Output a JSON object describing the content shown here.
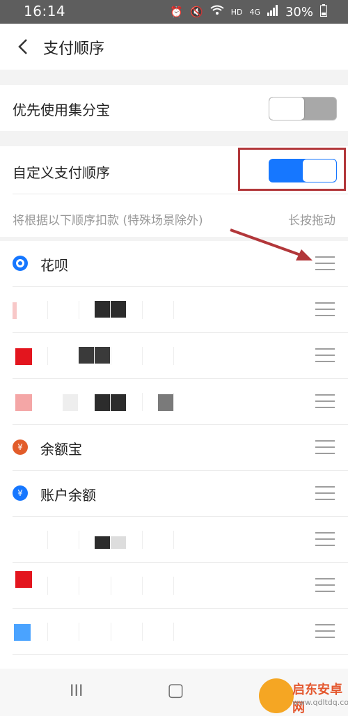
{
  "status_bar": {
    "time": "16:14",
    "network": "HD",
    "signal": "4G",
    "battery": "30%"
  },
  "header": {
    "title": "支付顺序"
  },
  "settings": {
    "prefer_jifenbao": {
      "label": "优先使用集分宝",
      "enabled": false
    },
    "custom_order": {
      "label": "自定义支付顺序",
      "enabled": true
    }
  },
  "hint": {
    "text": "将根据以下顺序扣款 (特殊场景除外)",
    "action": "长按拖动"
  },
  "payment_methods": [
    {
      "label": "花呗",
      "icon": "huabei-icon",
      "color": "#1677ff"
    },
    {
      "label": "",
      "icon": "blurred-card-icon"
    },
    {
      "label": "",
      "icon": "blurred-card-icon",
      "color": "#e3151e"
    },
    {
      "label": "",
      "icon": "blurred-card-icon",
      "color": "#f4a6a6"
    },
    {
      "label": "余额宝",
      "icon": "yuebao-icon",
      "color": "#e25c2a"
    },
    {
      "label": "账户余额",
      "icon": "balance-icon",
      "color": "#1677ff"
    },
    {
      "label": "",
      "icon": "blurred-card-icon"
    },
    {
      "label": "",
      "icon": "blurred-card-icon",
      "color": "#e3151e"
    },
    {
      "label": "",
      "icon": "blurred-card-icon",
      "color": "#4aa3ff"
    }
  ],
  "bottom_nav": {
    "recent_glyph": "III",
    "home_glyph": "▢"
  },
  "watermark": {
    "brand": "启东安卓网",
    "url": "www.qdltdq.com"
  },
  "colors": {
    "accent": "#1677ff",
    "highlight": "#b2373a"
  }
}
